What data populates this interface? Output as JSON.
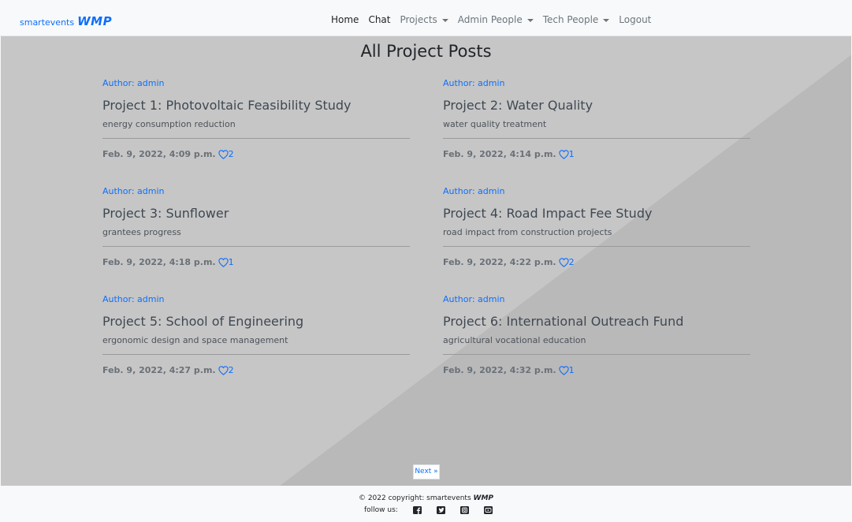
{
  "navbar": {
    "brand_text": "smartevents",
    "brand_logo": "WMP",
    "items": [
      {
        "label": "Home",
        "dropdown": false
      },
      {
        "label": "Chat",
        "dropdown": false
      },
      {
        "label": "Projects",
        "dropdown": true
      },
      {
        "label": "Admin People",
        "dropdown": true
      },
      {
        "label": "Tech People",
        "dropdown": true
      },
      {
        "label": "Logout",
        "dropdown": false
      }
    ]
  },
  "page": {
    "title": "All Project Posts"
  },
  "posts": [
    {
      "author": "Author: admin",
      "title": "Project 1: Photovoltaic Feasibility Study",
      "description": "energy consumption reduction",
      "date": "Feb. 9, 2022, 4:09 p.m.",
      "likes": "2"
    },
    {
      "author": "Author: admin",
      "title": "Project 2: Water Quality",
      "description": "water quality treatment",
      "date": "Feb. 9, 2022, 4:14 p.m.",
      "likes": "1"
    },
    {
      "author": "Author: admin",
      "title": "Project 3: Sunflower",
      "description": "grantees progress",
      "date": "Feb. 9, 2022, 4:18 p.m.",
      "likes": "1"
    },
    {
      "author": "Author: admin",
      "title": "Project 4: Road Impact Fee Study",
      "description": "road impact from construction projects",
      "date": "Feb. 9, 2022, 4:22 p.m.",
      "likes": "2"
    },
    {
      "author": "Author: admin",
      "title": "Project 5: School of Engineering",
      "description": "ergonomic design and space management",
      "date": "Feb. 9, 2022, 4:27 p.m.",
      "likes": "2"
    },
    {
      "author": "Author: admin",
      "title": "Project 6: International Outreach Fund",
      "description": "agricultural vocational education",
      "date": "Feb. 9, 2022, 4:32 p.m.",
      "likes": "1"
    }
  ],
  "pagination": {
    "next_label": "Next »"
  },
  "footer": {
    "copyright": "© 2022 copyright: smartevents",
    "logo": "WMP",
    "follow_label": "follow us:",
    "social_icons": [
      "facebook-icon",
      "twitter-icon",
      "instagram-icon",
      "youtube-icon"
    ]
  },
  "colors": {
    "accent": "#0d6efd",
    "navbar_bg": "#f8f9fa",
    "main_bg": "#c6c6c6"
  }
}
